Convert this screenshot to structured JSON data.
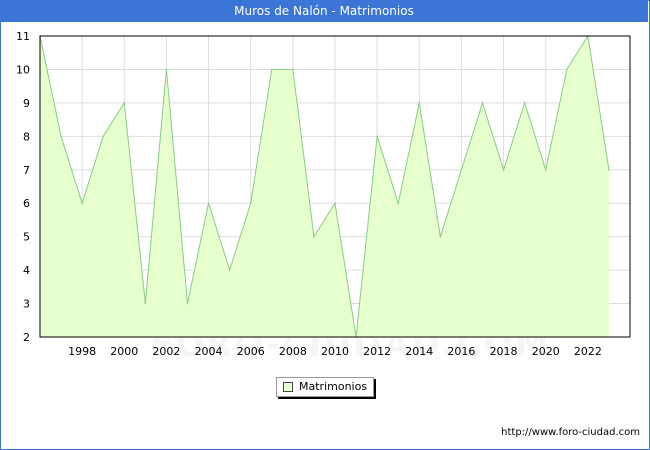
{
  "title": "Muros de Nalón - Matrimonios",
  "watermark": "FORO-CIUDAD.COM",
  "url": "http://www.foro-ciudad.com",
  "chart_data": {
    "type": "area",
    "title": "Muros de Nalón - Matrimonios",
    "x": [
      1996,
      1997,
      1998,
      1999,
      2000,
      2001,
      2002,
      2003,
      2004,
      2005,
      2006,
      2007,
      2008,
      2009,
      2010,
      2011,
      2012,
      2013,
      2014,
      2015,
      2016,
      2017,
      2018,
      2019,
      2020,
      2021,
      2022,
      2023
    ],
    "series": [
      {
        "name": "Matrimonios",
        "values": [
          11,
          8,
          6,
          8,
          9,
          3,
          10,
          3,
          6,
          4,
          6,
          10,
          10,
          5,
          6,
          2,
          8,
          6,
          9,
          5,
          7,
          9,
          7,
          9,
          7,
          10,
          11,
          7
        ]
      }
    ],
    "xticks": [
      "1998",
      "2000",
      "2002",
      "2004",
      "2006",
      "2008",
      "2010",
      "2012",
      "2014",
      "2016",
      "2018",
      "2020",
      "2022"
    ],
    "yticks": [
      "2",
      "3",
      "4",
      "5",
      "6",
      "7",
      "8",
      "9",
      "10",
      "11"
    ],
    "ylim": [
      2,
      11
    ],
    "xlim": [
      1996,
      2024
    ],
    "grid": true,
    "legend": "bottom-center",
    "colors": {
      "fill": "#e6ffcc",
      "line": "#88cc88",
      "grid": "#dddddd",
      "frame": "#3b76d6"
    }
  }
}
